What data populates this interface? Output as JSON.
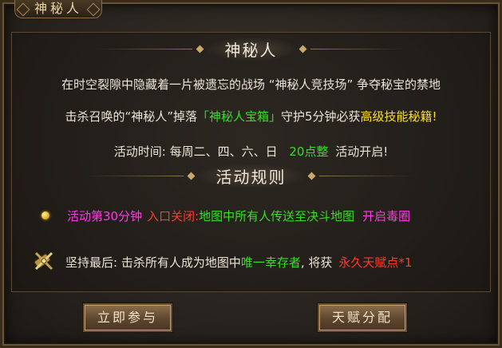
{
  "window": {
    "title": "神秘人"
  },
  "intro": {
    "header": "神秘人",
    "line1": "在时空裂隙中隐藏着一片被遗忘的战场 “神秘人竞技场” 争夺秘宝的禁地",
    "line2": {
      "part1": "击杀召唤的“神秘人”掉落",
      "highlight1": "「神秘人宝箱」",
      "part2": "守护5分钟必获",
      "highlight2": "高级技能秘籍!"
    },
    "line3": {
      "prefix": "活动时间: 每周二、四、六、日",
      "time": "20点整",
      "suffix": "活动开启!"
    }
  },
  "rules": {
    "header": "活动规则",
    "rule1": {
      "part1": "活动第30分钟",
      "part2": "入口关闭:",
      "part3": "地图中所有人传送至决斗地图",
      "part4": "开启毒圈"
    },
    "rule2": {
      "part1": "坚持最后: 击杀所有人成为地图中",
      "part2": "唯一幸存者",
      "part3": ", 将获",
      "part4": "永久天赋点*1"
    }
  },
  "buttons": {
    "join": "立即参与",
    "talent": "天赋分配"
  },
  "colors": {
    "green": "#34e021",
    "yellow": "#f5e02a",
    "magenta": "#ff39e6",
    "red": "#ff3a2a"
  },
  "icons": [
    "gold-orb-bullet-icon",
    "crossed-swords-icon"
  ]
}
